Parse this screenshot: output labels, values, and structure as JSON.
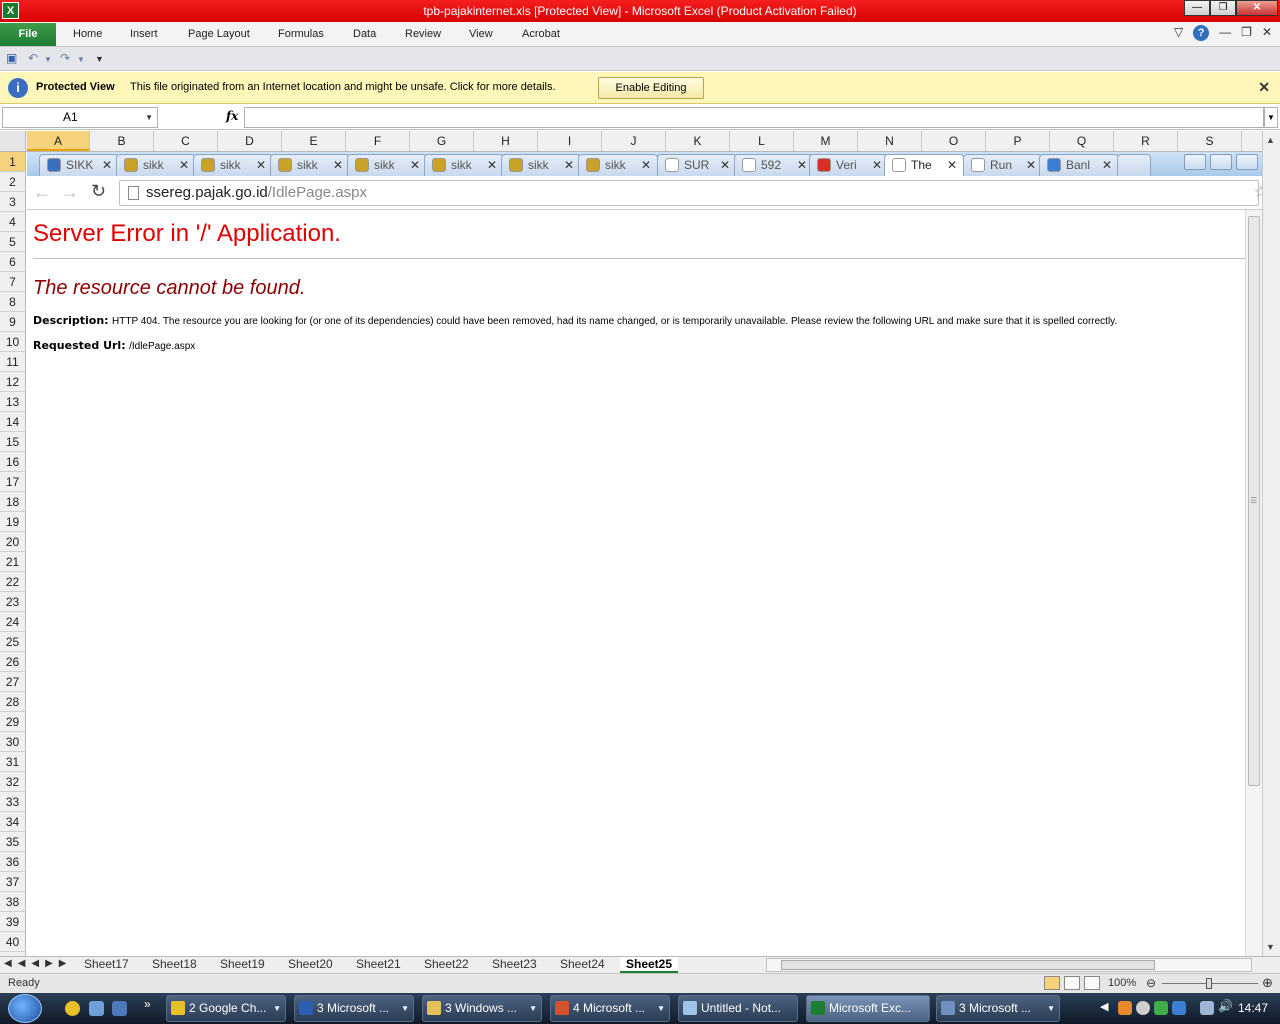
{
  "window": {
    "title": "tpb-pajakinternet.xls  [Protected View]  -  Microsoft Excel (Product Activation Failed)",
    "app_icon": "X"
  },
  "ribbon": {
    "file_label": "File",
    "tabs": [
      "Home",
      "Insert",
      "Page Layout",
      "Formulas",
      "Data",
      "Review",
      "View",
      "Acrobat"
    ]
  },
  "protected_view": {
    "title": "Protected View",
    "message": "This file originated from an Internet location and might be unsafe. Click for more details.",
    "button": "Enable Editing",
    "close": "✕"
  },
  "formula_bar": {
    "name_box": "A1",
    "fx": "fx",
    "formula": ""
  },
  "columns": [
    "A",
    "B",
    "C",
    "D",
    "E",
    "F",
    "G",
    "H",
    "I",
    "J",
    "K",
    "L",
    "M",
    "N",
    "O",
    "P",
    "Q",
    "R",
    "S"
  ],
  "selected_column": "A",
  "rows": [
    "1",
    "2",
    "3",
    "4",
    "5",
    "6",
    "7",
    "8",
    "9",
    "10",
    "11",
    "12",
    "13",
    "14",
    "15",
    "16",
    "17",
    "18",
    "19",
    "20",
    "21",
    "22",
    "23",
    "24",
    "25",
    "26",
    "27",
    "28",
    "29",
    "30",
    "31",
    "32",
    "33",
    "34",
    "35",
    "36",
    "37",
    "38",
    "39",
    "40"
  ],
  "selected_row": "1",
  "browser": {
    "tabs": [
      {
        "label": "SIKK",
        "icon": "chart-favicon",
        "color": "#3a6fbf"
      },
      {
        "label": "sikk",
        "icon": "people-favicon",
        "color": "#c9a227"
      },
      {
        "label": "sikk",
        "icon": "people-favicon",
        "color": "#c9a227"
      },
      {
        "label": "sikk",
        "icon": "people-favicon",
        "color": "#c9a227"
      },
      {
        "label": "sikk",
        "icon": "people-favicon",
        "color": "#c9a227"
      },
      {
        "label": "sikk",
        "icon": "people-favicon",
        "color": "#c9a227"
      },
      {
        "label": "sikk",
        "icon": "people-favicon",
        "color": "#c9a227"
      },
      {
        "label": "sikk",
        "icon": "people-favicon",
        "color": "#c9a227"
      },
      {
        "label": "SUR",
        "icon": "page-favicon",
        "color": "#ffffff"
      },
      {
        "label": "592",
        "icon": "page-favicon",
        "color": "#ffffff"
      },
      {
        "label": "Veri",
        "icon": "gmail-favicon",
        "color": "#d93025"
      },
      {
        "label": "The",
        "icon": "page-favicon",
        "color": "#ffffff"
      },
      {
        "label": "Run",
        "icon": "page-favicon",
        "color": "#ffffff"
      },
      {
        "label": "Banl",
        "icon": "loading-favicon",
        "color": "#3a7fd5"
      }
    ],
    "active_tab": 11,
    "url_host": "ssereg.pajak.go.id",
    "url_path": "/IdlePage.aspx",
    "page": {
      "h1": "Server Error in '/' Application.",
      "h2": "The resource cannot be found.",
      "description_label": "Description:",
      "description_text": "HTTP 404. The resource you are looking for (or one of its dependencies) could have been removed, had its name changed, or is temporarily unavailable.  Please review the following URL and make sure that it is spelled correctly.",
      "requested_label": "Requested Url:",
      "requested_value": "/IdlePage.aspx"
    }
  },
  "sheets": [
    "Sheet17",
    "Sheet18",
    "Sheet19",
    "Sheet20",
    "Sheet21",
    "Sheet22",
    "Sheet23",
    "Sheet24",
    "Sheet25"
  ],
  "active_sheet": "Sheet25",
  "status": {
    "ready": "Ready",
    "zoom": "100%"
  },
  "taskbar": {
    "more": "»",
    "buttons": [
      {
        "label": "2 Google Ch...",
        "icon": "chrome-icon",
        "color": "#e8c02a"
      },
      {
        "label": "3 Microsoft ...",
        "icon": "word-icon",
        "color": "#2b5fb4"
      },
      {
        "label": "3 Windows ...",
        "icon": "folder-icon",
        "color": "#e2c15a"
      },
      {
        "label": "4 Microsoft ...",
        "icon": "powerpoint-icon",
        "color": "#d2522b"
      },
      {
        "label": "Untitled - Not...",
        "icon": "notepad-icon",
        "color": "#9fc4e8"
      },
      {
        "label": "Microsoft Exc...",
        "icon": "excel-icon",
        "color": "#1f7d33"
      },
      {
        "label": "3 Microsoft ...",
        "icon": "generic-app-icon",
        "color": "#6f8fbf"
      }
    ],
    "active_button": 5,
    "clock": "14:47"
  }
}
